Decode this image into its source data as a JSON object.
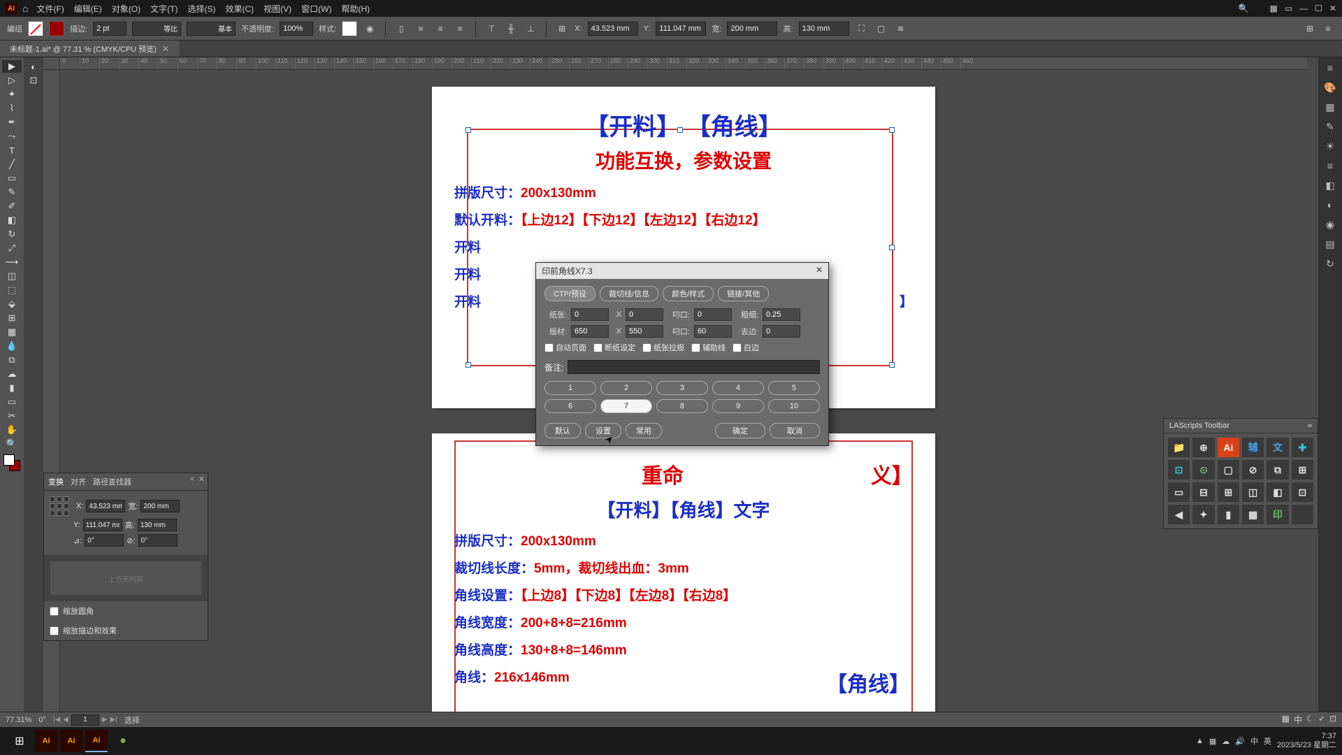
{
  "menu": {
    "file": "文件(F)",
    "edit": "编辑(E)",
    "object": "对象(O)",
    "text": "文字(T)",
    "select": "选择(S)",
    "effect": "效果(C)",
    "view": "视图(V)",
    "window": "窗口(W)",
    "help": "帮助(H)"
  },
  "controlbar": {
    "mode": "编组",
    "strokeLabel": "描边:",
    "strokeVal": "2 pt",
    "dash1": "等比",
    "dash2": "基本",
    "opacityLabel": "不透明度:",
    "opacityVal": "100%",
    "styleLabel": "样式:",
    "xLabel": "X:",
    "xVal": "43.523 mm",
    "yLabel": "Y:",
    "yVal": "111.047 mm",
    "wLabel": "宽:",
    "wVal": "200 mm",
    "hLabel": "高:",
    "hVal": "130 mm"
  },
  "docTab": "未标题-1.ai* @ 77.31 % (CMYK/CPU 预览)",
  "page1": {
    "h1a": "【开料】",
    "h1b": "【角线】",
    "h2": "功能互换，参数设置",
    "l1l": "拼版尺寸：",
    "l1v": "200x130mm",
    "l2l": "默认开料：",
    "l2v": "【上边12】【下边12】【左边12】【右边12】",
    "l3l": "开料",
    "l4l": "开料",
    "l5l": "开料",
    "l5v": "】"
  },
  "page2": {
    "top": "重命",
    "topv": "义】",
    "tag": "【开料】【角线】文字",
    "l1l": "拼版尺寸：",
    "l1v": "200x130mm",
    "l2l": "裁切线长度：",
    "l2v": "5mm，裁切线出血：3mm",
    "l3l": "角线设置：",
    "l3v": "【上边8】【下边8】【左边8】【右边8】",
    "l4l": "角线宽度：",
    "l4v": "200+8+8=216mm",
    "l5l": "角线高度：",
    "l5v": "130+8+8=146mm",
    "l6l": "角线：",
    "l6v": "216x146mm",
    "big": "【角线】"
  },
  "dialog": {
    "title": "印前角线X7.3",
    "tabs": [
      "CTP/预设",
      "裁切线/信息",
      "颜色/样式",
      "链接/其他"
    ],
    "f1l": "纸张:",
    "f1v": "0",
    "f1xl": "X",
    "f1xv": "0",
    "f1bl": "叼口:",
    "f1bv": "0",
    "f1cl": "粗细:",
    "f1cv": "0.25",
    "f2l": "版材:",
    "f2v": "650",
    "f2xl": "X",
    "f2xv": "550",
    "f2bl": "叼口:",
    "f2bv": "60",
    "f2cl": "去边:",
    "f2cv": "0",
    "chk": [
      "自动页面",
      "断纸设定",
      "纸张拉规",
      "辅助线",
      "白边"
    ],
    "remarkLabel": "备注:",
    "presets": [
      "1",
      "2",
      "3",
      "4",
      "5",
      "6",
      "7",
      "8",
      "9",
      "10"
    ],
    "activePreset": "7",
    "btns": {
      "default": "默认",
      "setting": "设置",
      "common": "常用",
      "ok": "确定",
      "cancel": "取消"
    }
  },
  "transform": {
    "tabs": [
      "变换",
      "对齐",
      "路径查找器"
    ],
    "xLabel": "X:",
    "xVal": "43.523 mm",
    "wLabel": "宽:",
    "wVal": "200 mm",
    "yLabel": "Y:",
    "yVal": "111.047 mm",
    "hLabel": "高:",
    "hVal": "130 mm",
    "ang1Label": "⊿:",
    "ang1": "0°",
    "ang2Label": "⊘:",
    "ang2": "0°",
    "placeholder": "上方无内容",
    "chk1": "缩放圆角",
    "chk2": "缩放描边和效果"
  },
  "lascripts": {
    "title": "LAScripts Toolbar",
    "btns": [
      "📁",
      "⊕",
      "Ai",
      "辅",
      "文",
      "✚",
      "⊡",
      "⊙",
      "▢",
      "⊘",
      "⧉",
      "⊞",
      "▭",
      "⊟",
      "⊞",
      "◫",
      "◧",
      "⊡",
      "◀",
      "✦",
      "▮",
      "▦",
      "印",
      ""
    ]
  },
  "status": {
    "zoom": "77.31%",
    "angle": "0°",
    "page": "1",
    "sel": "选择"
  },
  "taskbar": {
    "time": "7:37",
    "date": "2023/5/23 星期二"
  },
  "rulerTicks": [
    "0",
    "10",
    "20",
    "30",
    "40",
    "50",
    "60",
    "70",
    "80",
    "90",
    "100",
    "110",
    "120",
    "130",
    "140",
    "150",
    "160",
    "170",
    "180",
    "190",
    "200",
    "210",
    "220",
    "230",
    "240",
    "250",
    "260",
    "270",
    "280",
    "290",
    "300",
    "310",
    "320",
    "330",
    "340",
    "350",
    "360",
    "370",
    "380",
    "390",
    "400",
    "410",
    "420",
    "430",
    "440",
    "450",
    "460"
  ]
}
